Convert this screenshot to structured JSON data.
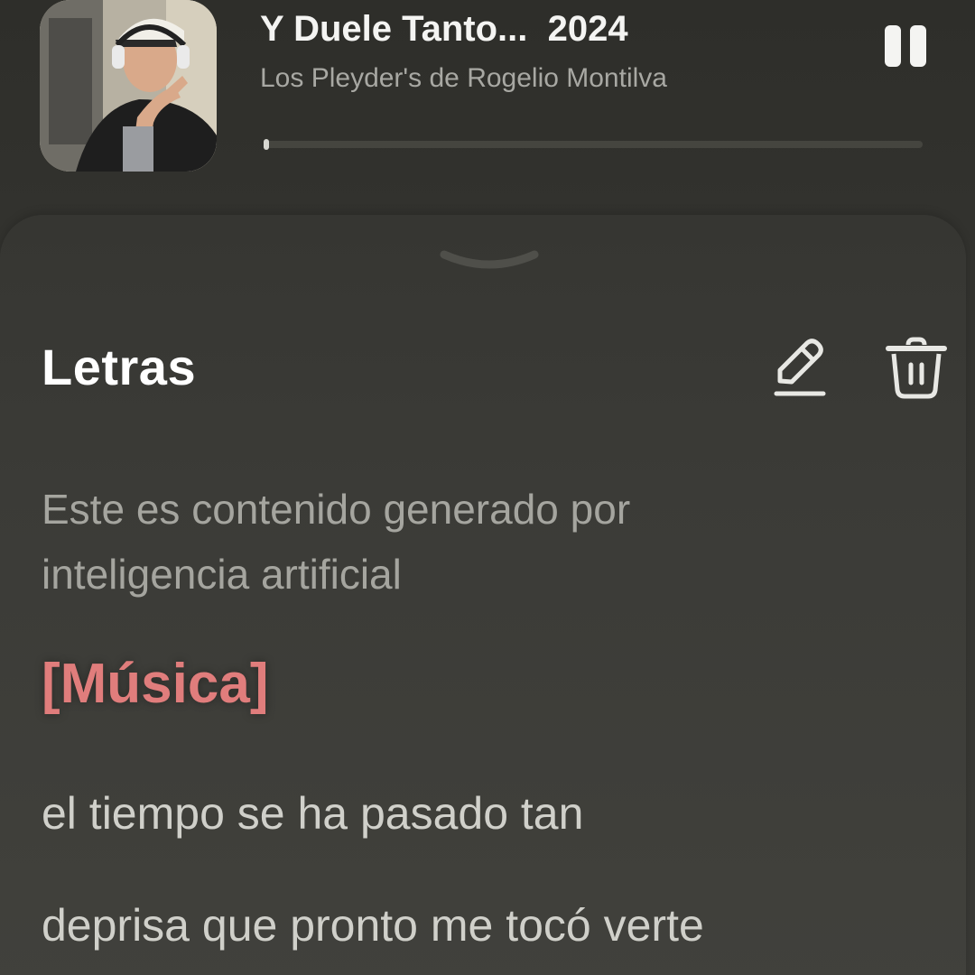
{
  "player": {
    "title": "Y Duele Tanto...  2024",
    "artist": "Los Pleyder's de Rogelio Montilva",
    "progress_fraction": 0.006,
    "pause_icon": "pause-icon",
    "cover_icon": "album-cover"
  },
  "lyrics_sheet": {
    "handle_icon": "chevron-down-icon",
    "title": "Letras",
    "edit_icon": "pencil-icon",
    "delete_icon": "trash-icon",
    "ai_notice": "Este es contenido generado por inteligencia artificial",
    "section_tag": "[Música]",
    "lines": [
      "el tiempo se ha pasado tan",
      "deprisa que pronto me tocó verte"
    ]
  },
  "colors": {
    "background": "#2f2f2b",
    "accent": "#e07d7c",
    "primary_text": "#f4f4f2",
    "secondary_text": "#a8a8a3"
  }
}
